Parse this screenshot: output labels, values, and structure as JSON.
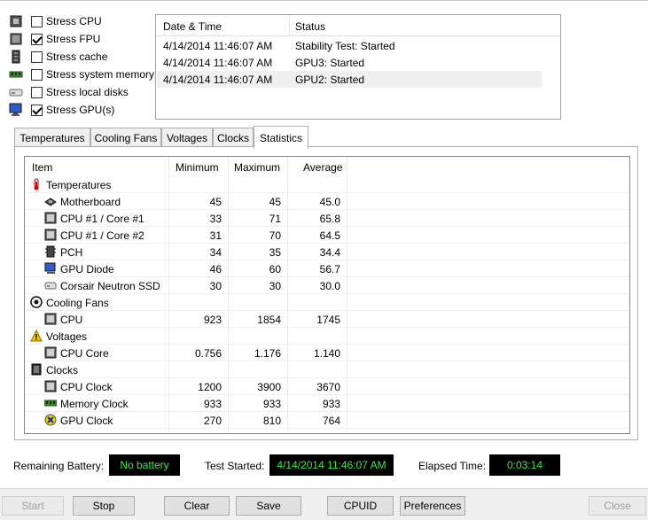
{
  "stress_options": [
    {
      "label": "Stress CPU",
      "checked": false,
      "icon": "cpu-chip-icon"
    },
    {
      "label": "Stress FPU",
      "checked": true,
      "icon": "fpu-chip-icon"
    },
    {
      "label": "Stress cache",
      "checked": false,
      "icon": "cache-icon"
    },
    {
      "label": "Stress system memory",
      "checked": false,
      "icon": "memory-icon"
    },
    {
      "label": "Stress local disks",
      "checked": false,
      "icon": "disk-icon"
    },
    {
      "label": "Stress GPU(s)",
      "checked": true,
      "icon": "gpu-monitor-icon"
    }
  ],
  "log": {
    "columns": [
      "Date & Time",
      "Status"
    ],
    "rows": [
      {
        "time": "4/14/2014 11:46:07 AM",
        "status": "Stability Test: Started"
      },
      {
        "time": "4/14/2014 11:46:07 AM",
        "status": "GPU3: Started"
      },
      {
        "time": "4/14/2014 11:46:07 AM",
        "status": "GPU2: Started"
      }
    ]
  },
  "tabs": [
    "Temperatures",
    "Cooling Fans",
    "Voltages",
    "Clocks",
    "Statistics"
  ],
  "active_tab": "Statistics",
  "stats": {
    "columns": [
      "Item",
      "Minimum",
      "Maximum",
      "Average"
    ],
    "rows": [
      {
        "type": "group",
        "name": "Temperatures",
        "icon": "thermometer-icon"
      },
      {
        "type": "item",
        "name": "Motherboard",
        "icon": "motherboard-icon",
        "min": "45",
        "max": "45",
        "avg": "45.0"
      },
      {
        "type": "item",
        "name": "CPU #1 / Core #1",
        "icon": "cpu-core-icon",
        "min": "33",
        "max": "71",
        "avg": "65.8"
      },
      {
        "type": "item",
        "name": "CPU #1 / Core #2",
        "icon": "cpu-core-icon",
        "min": "31",
        "max": "70",
        "avg": "64.5"
      },
      {
        "type": "item",
        "name": "PCH",
        "icon": "pch-chip-icon",
        "min": "34",
        "max": "35",
        "avg": "34.4"
      },
      {
        "type": "item",
        "name": "GPU Diode",
        "icon": "gpu-monitor-icon",
        "min": "46",
        "max": "60",
        "avg": "56.7"
      },
      {
        "type": "item",
        "name": "Corsair Neutron SSD",
        "icon": "disk-icon",
        "min": "30",
        "max": "30",
        "avg": "30.0"
      },
      {
        "type": "group",
        "name": "Cooling Fans",
        "icon": "fan-icon"
      },
      {
        "type": "item",
        "name": "CPU",
        "icon": "cpu-core-icon",
        "min": "923",
        "max": "1854",
        "avg": "1745"
      },
      {
        "type": "group",
        "name": "Voltages",
        "icon": "warning-icon"
      },
      {
        "type": "item",
        "name": "CPU Core",
        "icon": "cpu-core-icon",
        "min": "0.756",
        "max": "1.176",
        "avg": "1.140"
      },
      {
        "type": "group",
        "name": "Clocks",
        "icon": "clock-chip-icon"
      },
      {
        "type": "item",
        "name": "CPU Clock",
        "icon": "cpu-core-icon",
        "min": "1200",
        "max": "3900",
        "avg": "3670"
      },
      {
        "type": "item",
        "name": "Memory Clock",
        "icon": "memory-icon",
        "min": "933",
        "max": "933",
        "avg": "933"
      },
      {
        "type": "item",
        "name": "GPU Clock",
        "icon": "gpu-x-icon",
        "min": "270",
        "max": "810",
        "avg": "764"
      }
    ]
  },
  "status": {
    "battery_label": "Remaining Battery:",
    "battery_value": "No battery",
    "started_label": "Test Started:",
    "started_value": "4/14/2014 11:46:07 AM",
    "elapsed_label": "Elapsed Time:",
    "elapsed_value": "0:03:14"
  },
  "buttons": {
    "start": "Start",
    "stop": "Stop",
    "clear": "Clear",
    "save": "Save",
    "cpuid": "CPUID",
    "preferences": "Preferences",
    "close": "Close"
  },
  "colors": {
    "status_text": "#3ee84a",
    "status_bg": "#000000",
    "selection": "#f0f0f0"
  }
}
